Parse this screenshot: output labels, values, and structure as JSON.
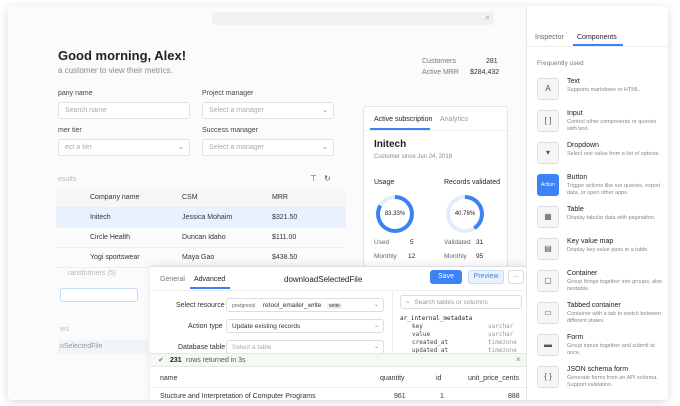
{
  "topbar": {
    "search_icon": "⌕",
    "menu_icon": "≡"
  },
  "greeting": "Good morning, Alex!",
  "subtitle": "a customer to view their metrics.",
  "stats": [
    {
      "label": "Customers",
      "value": "281"
    },
    {
      "label": "Active MRR",
      "value": "$284,432"
    }
  ],
  "filters": {
    "company_label": "pany name",
    "company_placeholder": "Search name",
    "pm_label": "Project manager",
    "pm_placeholder": "Select a manager",
    "tier_label": "mer tier",
    "tier_placeholder": "ect a tier",
    "sm_label": "Success manager",
    "sm_placeholder": "Select a manager"
  },
  "results_label": "esults",
  "table": {
    "headers": [
      "Company name",
      "CSM",
      "MRR"
    ],
    "rows": [
      {
        "company": "Initech",
        "csm": "Jessica Mohaim",
        "mrr": "$321.50"
      },
      {
        "company": "Circle Health",
        "csm": "Duncan Idaho",
        "mrr": "$111.00"
      },
      {
        "company": "Yogi sportswear",
        "csm": "Maya Gao",
        "mrr": "$438.50"
      }
    ]
  },
  "card": {
    "tabs": [
      "Active subscription",
      "Analytics"
    ],
    "company": "Initech",
    "since": "Customer since Jun 24, 2018",
    "usage": {
      "label": "Usage",
      "percent": "83.33%",
      "used_label": "Used",
      "used": "5",
      "monthly_label": "Monthly",
      "monthly": "12"
    },
    "records": {
      "label": "Records validated",
      "percent": "40.78%",
      "validated_label": "Validated",
      "validated": "31",
      "monthly_label": "Monthly",
      "monthly": "95"
    }
  },
  "left_faded": {
    "transformers": "ransformers (5)",
    "queries": "ies",
    "selected_file": "nSelectedFile"
  },
  "query": {
    "tabs": [
      "General",
      "Advanced"
    ],
    "name": "downloadSelectedFile",
    "save": "Save",
    "preview": "Preview",
    "more": "···",
    "resource_label": "Select resource",
    "resource_type": "postgresql",
    "resource_value": "retool_emailer_write",
    "resource_badge": "write",
    "action_label": "Action type",
    "action_value": "Update existing records",
    "db_label": "Database table",
    "db_value": "Select a table",
    "schema_search": "Search tables or columns",
    "schema_table": "ar_internal_metadata",
    "schema_cols": [
      {
        "name": "key",
        "type": "varchar"
      },
      {
        "name": "value",
        "type": "varchar"
      },
      {
        "name": "created_at",
        "type": "timezone"
      },
      {
        "name": "updated_at",
        "type": "timezone"
      }
    ],
    "result_count": "231",
    "result_text": "rows returned in 3s",
    "result_headers": [
      "name",
      "quantity",
      "id",
      "unit_price_cents"
    ],
    "result_rows": [
      {
        "name": "Stucture and Interpretation of Computer Programs",
        "quantity": "961",
        "id": "1",
        "price": "888"
      }
    ]
  },
  "inspector": {
    "tabs": [
      "Inspector",
      "Components"
    ],
    "section": "Frequently used",
    "components": [
      {
        "icon": "A",
        "name": "Text",
        "desc": "Supports markdown or HTML."
      },
      {
        "icon": "[ ]",
        "name": "Input",
        "desc": "Control other components or queries with text."
      },
      {
        "icon": "▾",
        "name": "Dropdown",
        "desc": "Select one value from a list of options."
      },
      {
        "icon": "Action",
        "name": "Button",
        "desc": "Trigger actions like run queries, export data, or open other apps."
      },
      {
        "icon": "▦",
        "name": "Table",
        "desc": "Display tabular data with pagination."
      },
      {
        "icon": "▤",
        "name": "Key value map",
        "desc": "Display key value pairs in a table."
      },
      {
        "icon": "▢",
        "name": "Container",
        "desc": "Group things together into groups, also nestable."
      },
      {
        "icon": "▭",
        "name": "Tabbed container",
        "desc": "Container with a tab to switch between different states."
      },
      {
        "icon": "▬",
        "name": "Form",
        "desc": "Group inputs together and submit at once."
      },
      {
        "icon": "{ }",
        "name": "JSON schema form",
        "desc": "Generate forms from an API schema. Support validation."
      }
    ]
  },
  "colors": {
    "accent": "#3b82f6",
    "selected_row": "#e8f1fd"
  }
}
